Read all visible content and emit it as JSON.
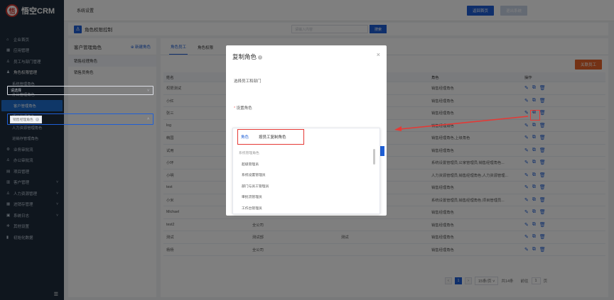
{
  "brand": {
    "logo_text": "悟空CRM",
    "logo_mark": "悟"
  },
  "topbar": {
    "crumb": "系统设置",
    "back_btn": "返回首页",
    "exit_btn": "退出系统"
  },
  "sidebar": {
    "items": [
      {
        "label": "企业首页",
        "icon": "⌂",
        "sub": false
      },
      {
        "label": "应用管理",
        "icon": "▦",
        "sub": false
      },
      {
        "label": "员工与部门管理",
        "icon": "♙",
        "sub": false
      },
      {
        "label": "角色权限管理",
        "icon": "♟",
        "sub": false,
        "open": true
      },
      {
        "label": "系统管理角色",
        "sub": true
      },
      {
        "label": "办公管理角色",
        "sub": true
      },
      {
        "label": "客户管理角色",
        "sub": true,
        "active": true
      },
      {
        "label": "项目管理角色",
        "sub": true
      },
      {
        "label": "人力资源管理角色",
        "sub": true
      },
      {
        "label": "进销存管理角色",
        "sub": true
      },
      {
        "label": "业务审批流",
        "icon": "⚙",
        "sub": false
      },
      {
        "label": "办公审批流",
        "icon": "♙",
        "sub": false
      },
      {
        "label": "项目管理",
        "icon": "▤",
        "sub": false
      },
      {
        "label": "客户管理",
        "icon": "▥",
        "sub": false,
        "arrow": "˅"
      },
      {
        "label": "人力资源管理",
        "icon": "♙",
        "sub": false,
        "arrow": "˅"
      },
      {
        "label": "进销存管理",
        "icon": "▦",
        "sub": false,
        "arrow": "˅"
      },
      {
        "label": "系统日志",
        "icon": "▣",
        "sub": false,
        "arrow": "˅"
      },
      {
        "label": "其他设置",
        "icon": "✲",
        "sub": false
      },
      {
        "label": "初始化数据",
        "icon": "▮",
        "sub": false
      }
    ],
    "collapse_icon": "☰"
  },
  "header2": {
    "title": "角色权限控制",
    "search_placeholder": "请输入内容",
    "search_btn": "搜索"
  },
  "left_panel": {
    "title": "客户管理角色",
    "new_role": "新建角色",
    "roles": [
      "销售经理角色",
      "销售员角色"
    ]
  },
  "main": {
    "tabs": [
      "角色员工",
      "角色权限"
    ],
    "relate_btn": "关联员工",
    "columns": [
      "姓名",
      "",
      "",
      "角色",
      "操作"
    ],
    "rows": [
      [
        "权限测试",
        "",
        "",
        "销售经理角色"
      ],
      [
        "小红",
        "",
        "",
        "销售经理角色"
      ],
      [
        "张三",
        "",
        "",
        "销售经理角色"
      ],
      [
        "log",
        "",
        "",
        "销售经理角色"
      ],
      [
        "韩国",
        "",
        "",
        "销售经理角色,上级角色"
      ],
      [
        "试用",
        "",
        "",
        "销售经理角色"
      ],
      [
        "小环",
        "",
        "",
        "系统设置管理员,公家管理员,销售经理角色..."
      ],
      [
        "小明",
        "",
        "",
        "人力资源管理员,销售经理角色,人力资源管理..."
      ],
      [
        "test",
        "",
        "",
        "销售经理角色"
      ],
      [
        "小米",
        "",
        "",
        "系统设置管理员,销售经理角色,项目管理员..."
      ],
      [
        "Michael",
        "销售部",
        "销售",
        "销售经理角色"
      ],
      [
        "test2",
        "全公司",
        "",
        "销售经理角色"
      ],
      [
        "测试",
        "测试部",
        "测试",
        "销售经理角色"
      ],
      [
        "杨杨",
        "全公司",
        "",
        "销售经理角色"
      ]
    ],
    "pager": {
      "prev": "‹",
      "page": "1",
      "next": "›",
      "size": "15条/页 ˅",
      "total": "共14条",
      "goto": "前往",
      "goto_page": "1",
      "unit": "页"
    }
  },
  "dialog": {
    "title": "复制角色",
    "help": "?",
    "close": "×",
    "label_emp": "选择员工和部门",
    "emp_placeholder": "请选择",
    "req_mark": "*",
    "label_role": "设置角色",
    "tag": "销售经理角色",
    "tag_x": "×",
    "dd_tab1": "角色",
    "dd_tab2": "按员工复制角色",
    "dd_group": "系统管理角色",
    "dd_items": [
      "超级管理员",
      "系统设置管理员",
      "部门与员工管理员",
      "审批流管理员",
      "工作台管理员"
    ]
  },
  "icons": {
    "edit": "✎",
    "copy": "⧉",
    "delete": "🗑"
  },
  "colors": {
    "primary": "#1f5fd6",
    "sidebar": "#1f2d3d",
    "accent": "#e8652b",
    "highlight": "#e53935"
  }
}
